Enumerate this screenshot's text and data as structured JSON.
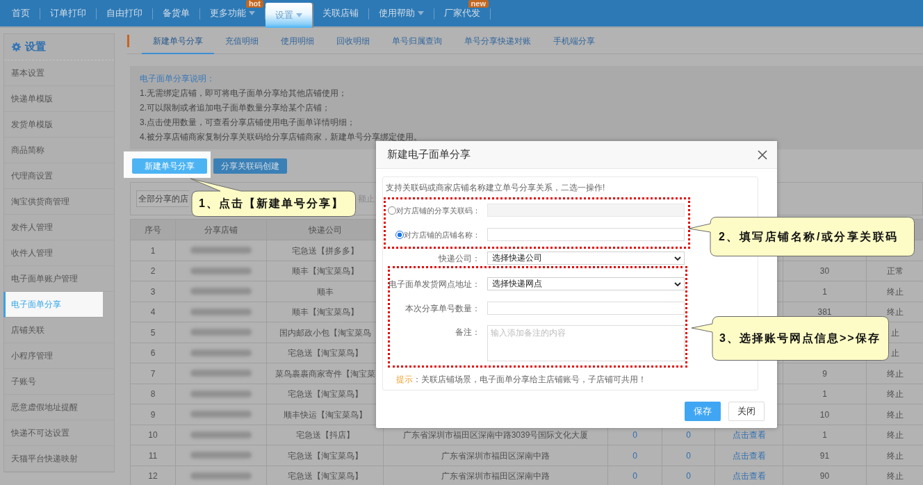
{
  "nav": {
    "items": [
      {
        "label": "首页",
        "selected": false,
        "dropdown": false
      },
      {
        "label": "订单打印",
        "selected": false,
        "dropdown": false
      },
      {
        "label": "自由打印",
        "selected": false,
        "dropdown": false
      },
      {
        "label": "备货单",
        "selected": false,
        "dropdown": false
      },
      {
        "label": "更多功能",
        "selected": false,
        "dropdown": true,
        "badge": "hot"
      },
      {
        "label": "设置",
        "selected": true,
        "dropdown": true
      },
      {
        "label": "关联店铺",
        "selected": false,
        "dropdown": false
      },
      {
        "label": "使用帮助",
        "selected": false,
        "dropdown": true
      },
      {
        "label": "厂家代发",
        "selected": false,
        "dropdown": false,
        "badge": "new"
      }
    ]
  },
  "sidebar": {
    "title": "设置",
    "items": [
      {
        "label": "基本设置",
        "selected": false
      },
      {
        "label": "快递单模版",
        "selected": false
      },
      {
        "label": "发货单模版",
        "selected": false
      },
      {
        "label": "商品简称",
        "selected": false
      },
      {
        "label": "代理商设置",
        "selected": false
      },
      {
        "label": "淘宝供货商管理",
        "selected": false
      },
      {
        "label": "发件人管理",
        "selected": false
      },
      {
        "label": "收件人管理",
        "selected": false
      },
      {
        "label": "电子面单账户管理",
        "selected": false
      },
      {
        "label": "电子面单分享",
        "selected": true
      },
      {
        "label": "店铺关联",
        "selected": false
      },
      {
        "label": "小程序管理",
        "selected": false
      },
      {
        "label": "子账号",
        "selected": false
      },
      {
        "label": "恶意虚假地址提醒",
        "selected": false
      },
      {
        "label": "快递不可达设置",
        "selected": false
      },
      {
        "label": "天猫平台快递映射",
        "selected": false
      }
    ]
  },
  "tabs": [
    {
      "label": "新建单号分享",
      "selected": true
    },
    {
      "label": "充值明细",
      "selected": false
    },
    {
      "label": "使用明细",
      "selected": false
    },
    {
      "label": "回收明细",
      "selected": false
    },
    {
      "label": "单号归属查询",
      "selected": false
    },
    {
      "label": "单号分享快递对账",
      "selected": false
    },
    {
      "label": "手机端分享",
      "selected": false
    }
  ],
  "description": {
    "title": "电子面单分享说明：",
    "lines": [
      "1.无需绑定店铺，即可将电子面单分享给其他店铺使用；",
      "2.可以限制或者追加电子面单数量分享给某个店铺；",
      "3.点击使用数量，可查看分享店铺使用电子面单详情明细；",
      "4.被分享店铺商家复制分享关联码给分享店铺商家，新建单号分享绑定使用。"
    ]
  },
  "actions": [
    {
      "label": "新建单号分享",
      "highlighted": true
    },
    {
      "label": "分享关联码创建",
      "highlighted": false
    }
  ],
  "filter": {
    "shop_select": "全部分享的店",
    "field_text": "额止"
  },
  "table": {
    "columns": [
      {
        "label": "序号"
      },
      {
        "label": "分享店铺"
      },
      {
        "label": "快递公司"
      }
    ],
    "rows": [
      {
        "no": "1",
        "courier": "宅急送【拼多多】"
      },
      {
        "no": "2",
        "courier": "顺丰【淘宝菜鸟】",
        "column_8": "30",
        "column_9": "正常"
      },
      {
        "no": "3",
        "courier": "顺丰",
        "column_8": "1",
        "column_9": "终止"
      },
      {
        "no": "4",
        "courier": "顺丰【淘宝菜鸟】",
        "column_8": "381",
        "column_9": "终止"
      },
      {
        "no": "5",
        "courier": "国内邮政小包【淘宝菜鸟",
        "column_9": "止"
      },
      {
        "no": "6",
        "courier": "宅急送【淘宝菜鸟】",
        "column_9": "止"
      },
      {
        "no": "7",
        "courier": "菜鸟裹裹商家寄件【淘宝菜",
        "column_8": "9",
        "column_9": "终止"
      },
      {
        "no": "8",
        "courier": "宅急送【淘宝菜鸟】",
        "column_8": "1",
        "column_9": "终止"
      },
      {
        "no": "9",
        "courier": "顺丰快运【淘宝菜鸟】",
        "column_8": "10",
        "column_9": "终止"
      },
      {
        "no": "10",
        "courier": "宅急送【抖店】",
        "column_4": "广东省深圳市福田区深南中路3039号国际文化大厦",
        "column_5": "0",
        "column_6": "0",
        "column_7": "点击查看",
        "column_8": "1",
        "column_9": "终止"
      },
      {
        "no": "11",
        "courier": "宅急送【淘宝菜鸟】",
        "column_4": "广东省深圳市福田区深南中路",
        "column_5": "0",
        "column_6": "0",
        "column_7": "点击查看",
        "column_8": "91",
        "column_9": "终止"
      },
      {
        "no": "12",
        "courier": "宅急送【淘宝菜鸟】",
        "column_4": "广东省深圳市福田区深南中路",
        "column_5": "0",
        "column_6": "0",
        "column_7": "点击查看",
        "column_8": "90",
        "column_9": "终止"
      }
    ]
  },
  "dialog": {
    "title": "新建电子面单分享",
    "intro": "支持关联码或商家店铺名称建立单号分享关系，二选一操作!",
    "choice_fields": [
      {
        "label": "对方店铺的分享关联码：",
        "selected": false
      },
      {
        "label": "对方店铺的店铺名称：",
        "selected": true
      }
    ],
    "courier_field": {
      "label": "快递公司：",
      "value": "选择快递公司"
    },
    "share_fields": [
      {
        "kind": "select",
        "label": "电子面单发货网点地址：",
        "value": "选择快递网点"
      },
      {
        "kind": "input",
        "label": "本次分享单号数量："
      },
      {
        "kind": "textarea",
        "label": "备注：",
        "placeholder": "输入添加备注的内容"
      }
    ],
    "hint": {
      "label": "提示",
      "text": "：关联店铺场景，电子面单分享给主店铺账号，子店铺可共用！"
    },
    "buttons": [
      {
        "label": "保存",
        "kind": "primary"
      },
      {
        "label": "关闭",
        "kind": "default"
      }
    ]
  },
  "callouts": [
    {
      "text": "1、点击【新建单号分享】"
    },
    {
      "text": "2、填写店铺名称/或分享关联码"
    },
    {
      "text": "3、选择账号网点信息>>保存"
    }
  ]
}
